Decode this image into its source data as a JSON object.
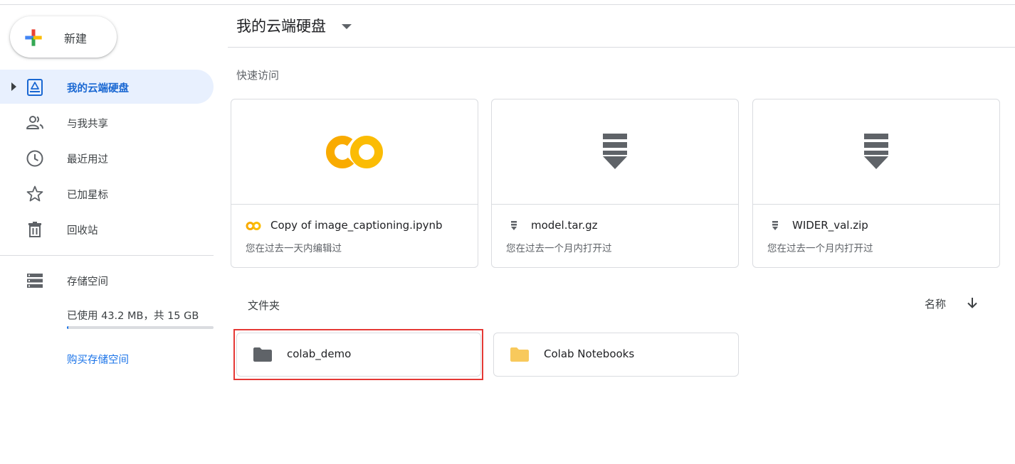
{
  "sidebar": {
    "new_label": "新建",
    "items": [
      {
        "label": "我的云端硬盘",
        "icon": "drive-icon",
        "active": true
      },
      {
        "label": "与我共享",
        "icon": "people-icon"
      },
      {
        "label": "最近用过",
        "icon": "clock-icon"
      },
      {
        "label": "已加星标",
        "icon": "star-icon"
      },
      {
        "label": "回收站",
        "icon": "trash-icon"
      }
    ],
    "storage": {
      "label": "存储空间",
      "icon": "storage-icon",
      "usage_text": "已使用 43.2 MB，共 15 GB",
      "used_fraction": 0.003,
      "buy_label": "购买存储空间"
    }
  },
  "header": {
    "title": "我的云端硬盘"
  },
  "quick_access": {
    "label": "快速访问",
    "cards": [
      {
        "name": "Copy of image_captioning.ipynb",
        "subtitle": "您在过去一天内编辑过",
        "icon": "colab-icon"
      },
      {
        "name": "model.tar.gz",
        "subtitle": "您在过去一个月内打开过",
        "icon": "archive-icon"
      },
      {
        "name": "WIDER_val.zip",
        "subtitle": "您在过去一个月内打开过",
        "icon": "archive-icon"
      }
    ]
  },
  "folders": {
    "label": "文件夹",
    "sort_label": "名称",
    "sort_icon": "arrow-down-icon",
    "items": [
      {
        "name": "colab_demo",
        "icon": "folder-icon",
        "color": "#5f6368",
        "highlighted": true
      },
      {
        "name": "Colab Notebooks",
        "icon": "folder-icon",
        "color": "#f8c95c"
      }
    ]
  },
  "colors": {
    "accent": "#1a73e8",
    "active_bg": "#e8f0fe",
    "highlight": "#e53935"
  }
}
